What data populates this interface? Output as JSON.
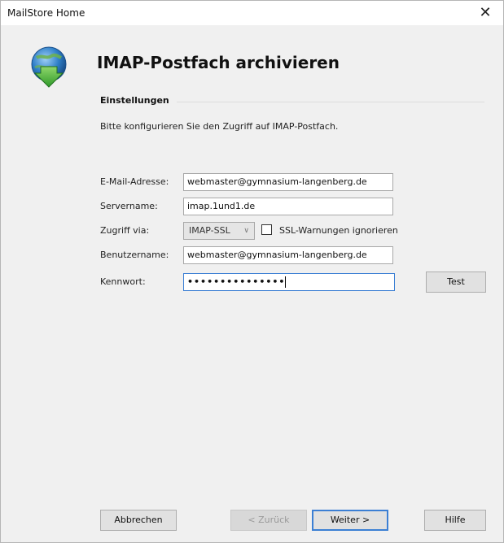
{
  "window": {
    "title": "MailStore Home",
    "close_glyph": "✕"
  },
  "app_icon": "mailstore-globe-download-icon",
  "heading": "IMAP-Postfach archivieren",
  "section": {
    "title": "Einstellungen",
    "description": "Bitte konfigurieren Sie den Zugriff auf IMAP-Postfach."
  },
  "form": {
    "email_label": "E-Mail-Adresse:",
    "email_value": "webmaster@gymnasium-langenberg.de",
    "server_label": "Servername:",
    "server_value": "imap.1und1.de",
    "access_label": "Zugriff via:",
    "access_value": "IMAP-SSL",
    "access_chevron": "∨",
    "ssl_checkbox_label": "SSL-Warnungen ignorieren",
    "ssl_checked": false,
    "user_label": "Benutzername:",
    "user_value": "webmaster@gymnasium-langenberg.de",
    "password_label": "Kennwort:",
    "password_value": "•••••••••••••••",
    "test_button": "Test"
  },
  "footer": {
    "cancel_button": "Abbrechen",
    "back_button": "< Zurück",
    "next_button": "Weiter >",
    "help_button": "Hilfe"
  },
  "colors": {
    "accent": "#3b7fd4",
    "background": "#f0f0f0"
  }
}
